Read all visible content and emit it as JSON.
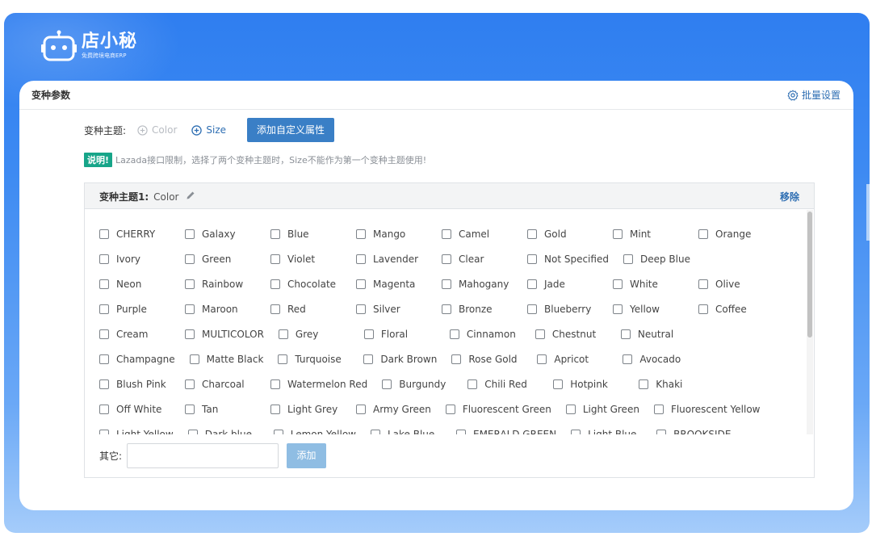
{
  "brand": {
    "name": "店小秘",
    "tagline": "免费跨境电商ERP"
  },
  "card": {
    "title": "变种参数",
    "batch_label": "批量设置"
  },
  "theme": {
    "label": "变种主题:",
    "options": [
      {
        "label": "Color",
        "state": "disabled"
      },
      {
        "label": "Size",
        "state": "active"
      }
    ],
    "custom_button": "添加自定义属性"
  },
  "note": {
    "badge": "说明!",
    "text": "Lazada接口限制，选择了两个变种主题时，Size不能作为第一个变种主题使用!"
  },
  "panel": {
    "title_prefix": "变种主题1:",
    "title_value": "Color",
    "remove_label": "移除",
    "rows": [
      [
        "CHERRY",
        "Galaxy",
        "Blue",
        "Mango",
        "Camel",
        "Gold",
        "Mint",
        "Orange"
      ],
      [
        "Ivory",
        "Green",
        "Violet",
        "Lavender",
        "Clear",
        "Not Specified",
        "Deep Blue"
      ],
      [
        "Neon",
        "Rainbow",
        "Chocolate",
        "Magenta",
        "Mahogany",
        "Jade",
        "White",
        "Olive"
      ],
      [
        "Purple",
        "Maroon",
        "Red",
        "Silver",
        "Bronze",
        "Blueberry",
        "Yellow",
        "Coffee"
      ],
      [
        "Cream",
        "MULTICOLOR",
        "Grey",
        "Floral",
        "Cinnamon",
        "Chestnut",
        "Neutral"
      ],
      [
        "Champagne",
        "Matte Black",
        "Turquoise",
        "Dark Brown",
        "Rose Gold",
        "Apricot",
        "Avocado"
      ],
      [
        "Blush Pink",
        "Charcoal",
        "Watermelon Red",
        "Burgundy",
        "Chili Red",
        "Hotpink",
        "Khaki"
      ],
      [
        "Off White",
        "Tan",
        "Light Grey",
        "Army Green",
        "Fluorescent Green",
        "Light Green",
        "Fluorescent Yellow"
      ],
      [
        "Light Yellow",
        "Dark blue",
        "Lemon Yellow",
        "Lake Blue",
        "EMERALD GREEN",
        "Light Blue",
        "BROOKSIDE"
      ]
    ],
    "other_label": "其它:",
    "other_input_value": "",
    "add_button": "添加"
  },
  "colors": {
    "accent": "#3a7fc6",
    "link": "#2f6fb3",
    "badge": "#17a589",
    "frame": "#2f7ef0"
  }
}
